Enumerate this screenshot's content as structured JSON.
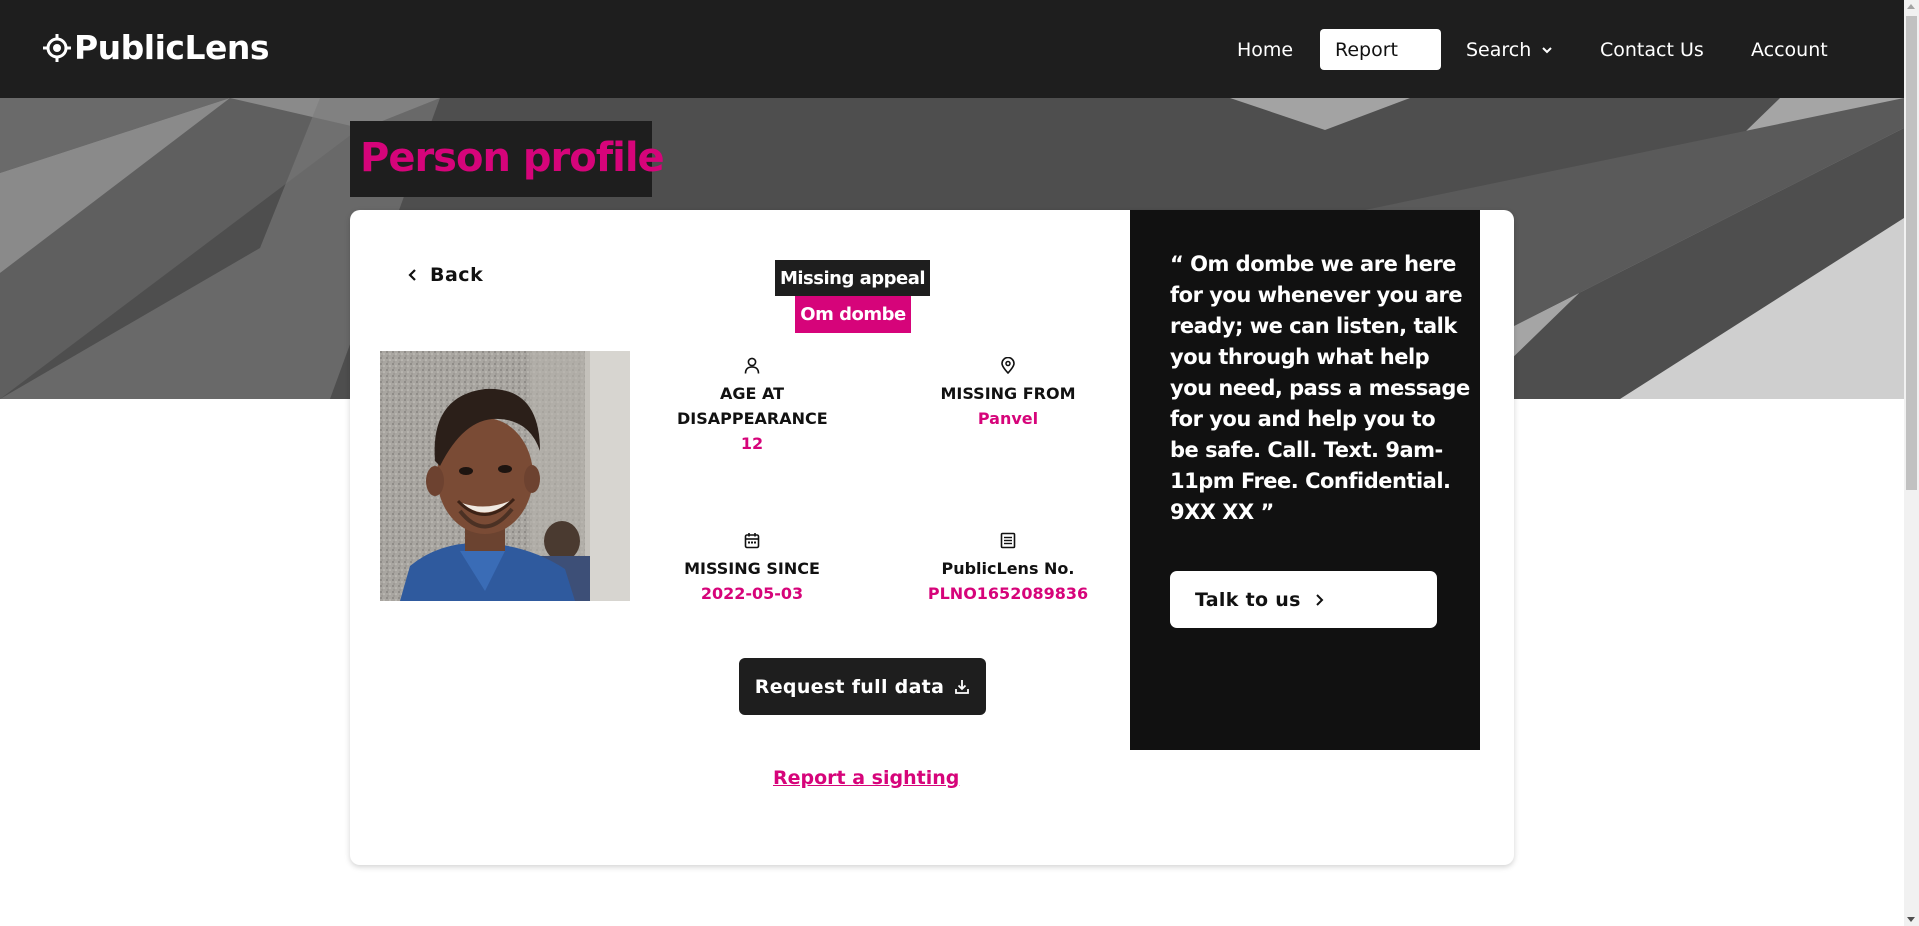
{
  "brand": {
    "name": "PublicLens",
    "icon": "crosshair-icon"
  },
  "nav": {
    "home": "Home",
    "report": "Report",
    "search": "Search",
    "contact": "Contact Us",
    "account": "Account"
  },
  "page": {
    "title": "Person profile"
  },
  "profile": {
    "back_label": "Back",
    "appeal_label": "Missing appeal",
    "name": "Om dombe",
    "photo_icon": "person-photo",
    "stats": {
      "age": {
        "label": "AGE AT DISAPPEARANCE",
        "value": "12",
        "icon": "person-icon"
      },
      "from": {
        "label": "MISSING FROM",
        "value": "Panvel",
        "icon": "map-pin-icon"
      },
      "since": {
        "label": "MISSING SINCE",
        "value": "2022-05-03",
        "icon": "calendar-icon"
      },
      "number": {
        "label": "PublicLens No.",
        "value": "PLNO1652089836",
        "icon": "list-icon"
      }
    },
    "request_label": "Request full data",
    "sighting_label": "Report a sighting"
  },
  "quote": {
    "text": "“ Om dombe we are here for you whenever you are ready; we can listen, talk you through what help you need, pass a message for you and help you to be safe. Call. Text. 9am-11pm Free. Confidential. 9XX XX ”",
    "button_label": "Talk to us"
  },
  "colors": {
    "accent": "#d6047a",
    "dark": "#1e1e1e",
    "panel": "#111111",
    "hero": "#4e4e4e"
  }
}
